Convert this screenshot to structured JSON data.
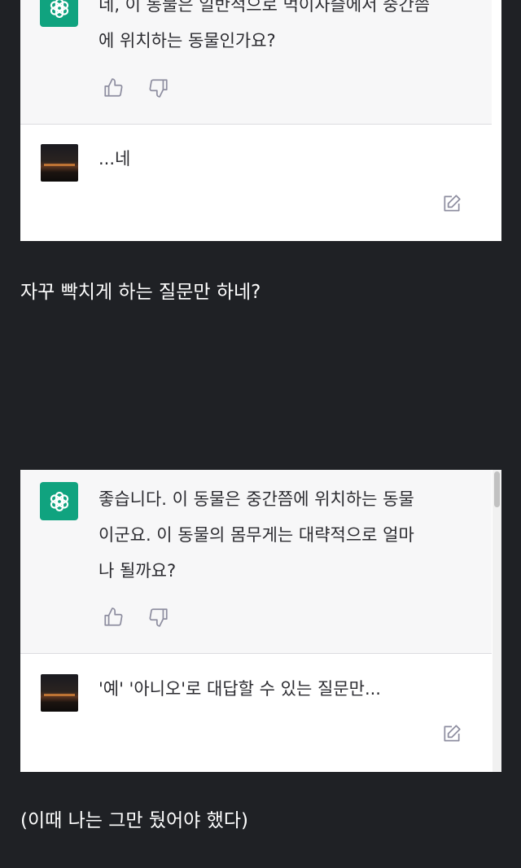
{
  "chat1": {
    "assistant_lines": [
      "네, 이 동물은 일반적으로 먹이사슬에서 중간쯤",
      "에 위치하는 동물인가요?"
    ],
    "user_text": "...네"
  },
  "caption1": "자꾸 빡치게 하는 질문만 하네?",
  "chat2": {
    "assistant_lines": [
      "좋습니다. 이 동물은 중간쯤에 위치하는 동물",
      "이군요. 이 동물의 몸무게는 대략적으로 얼마",
      "나 될까요?"
    ],
    "user_text": "'예' '아니오'로 대답할 수 있는 질문만..."
  },
  "caption2": "(이때 나는 그만 뒀어야 했다)",
  "icons": {
    "assistant_avatar": "openai-logo-icon",
    "like": "thumbs-up-icon",
    "dislike": "thumbs-down-icon",
    "edit": "edit-icon"
  },
  "colors": {
    "background": "#1f2125",
    "assistant_avatar": "#10a37f",
    "assistant_block": "#f7f7f8"
  }
}
